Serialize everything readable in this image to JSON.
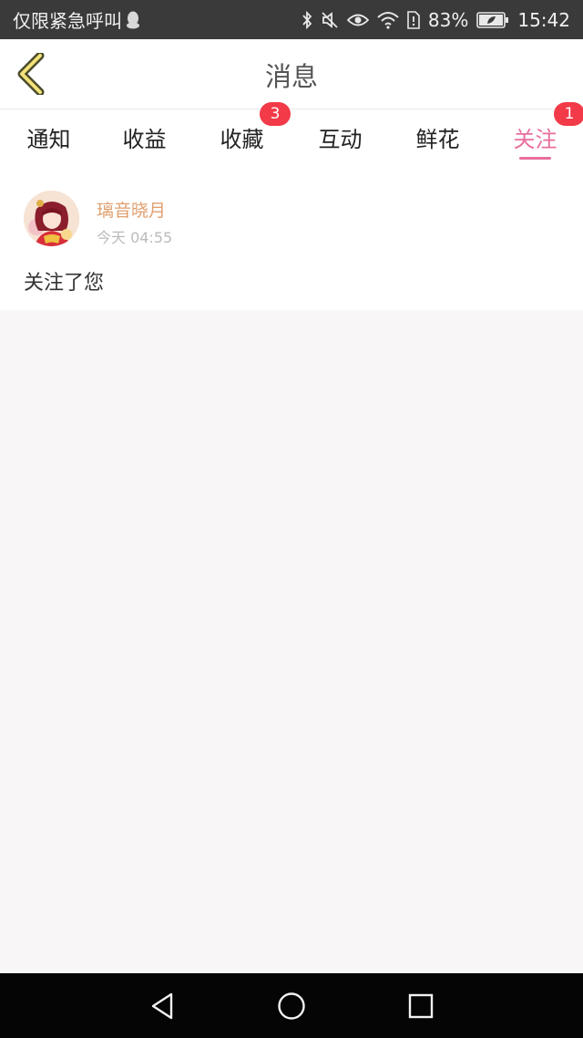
{
  "status_bar": {
    "notice": "仅限紧急呼叫",
    "battery": "83%",
    "time": "15:42",
    "icons": [
      "qq-icon",
      "bluetooth-icon",
      "mute-icon",
      "eye-icon",
      "wifi-icon",
      "sim-icon",
      "battery-icon"
    ]
  },
  "header": {
    "title": "消息"
  },
  "tabs": [
    {
      "label": "通知",
      "badge": ""
    },
    {
      "label": "收益",
      "badge": ""
    },
    {
      "label": "收藏",
      "badge": "3"
    },
    {
      "label": "互动",
      "badge": ""
    },
    {
      "label": "鲜花",
      "badge": ""
    },
    {
      "label": "关注",
      "badge": "1"
    }
  ],
  "active_tab": "关注",
  "messages": [
    {
      "user": "璃音晓月",
      "time": "今天 04:55",
      "text": "关注了您"
    }
  ],
  "colors": {
    "accent": "#e86e9e",
    "badge": "#f23a48",
    "username": "#e0a070",
    "status_bar": "#3a3a3a",
    "background": "#f8f6f7"
  }
}
